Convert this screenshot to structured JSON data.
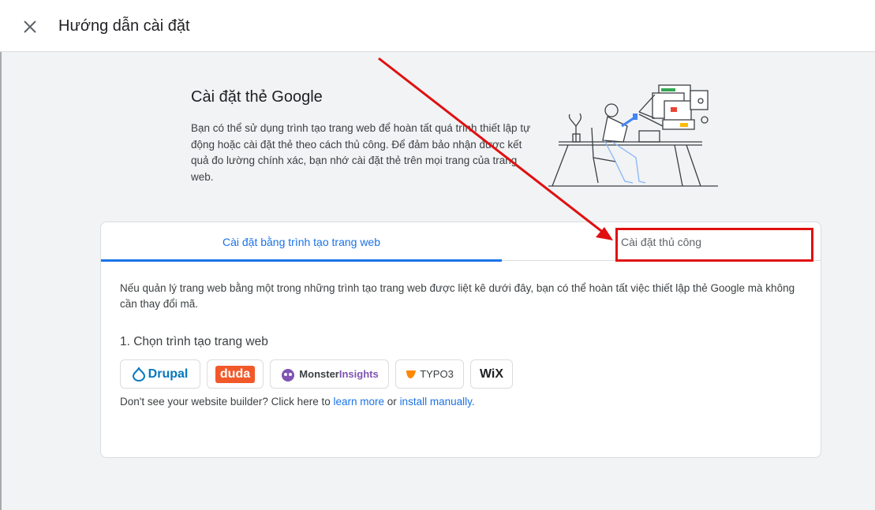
{
  "header": {
    "title": "Hướng dẫn cài đặt",
    "close_icon": "close-icon"
  },
  "hero": {
    "title": "Cài đặt thẻ Google",
    "description": "Bạn có thể sử dụng trình tạo trang web để hoàn tất quá trình thiết lập tự động hoặc cài đặt thẻ theo cách thủ công. Để đảm bảo nhận được kết quả đo lường chính xác, bạn nhớ cài đặt thẻ trên mọi trang của trang web."
  },
  "tabs": [
    {
      "label": "Cài đặt bằng trình tạo trang web",
      "active": true
    },
    {
      "label": "Cài đặt thủ công",
      "active": false
    }
  ],
  "card": {
    "description": "Nếu quản lý trang web bằng một trong những trình tạo trang web được liệt kê dưới đây, bạn có thể hoàn tất việc thiết lập thẻ Google mà không cần thay đổi mã.",
    "step_title": "1. Chọn trình tạo trang web",
    "builders": {
      "drupal": "Drupal",
      "duda": "duda",
      "monster_a": "Monster",
      "monster_b": "Insights",
      "typo3": "TYPO3",
      "wix": "WiX"
    },
    "footer_prefix": "Don't see your website builder? Click here to",
    "learn_more": "learn more",
    "footer_or": "or",
    "install_manually": "install manually."
  },
  "colors": {
    "accent": "#1a73e8",
    "annotation": "#e01010",
    "duda": "#f2592a",
    "drupal": "#0678be",
    "monster": "#7f54b3",
    "typo3": "#ff8700"
  }
}
